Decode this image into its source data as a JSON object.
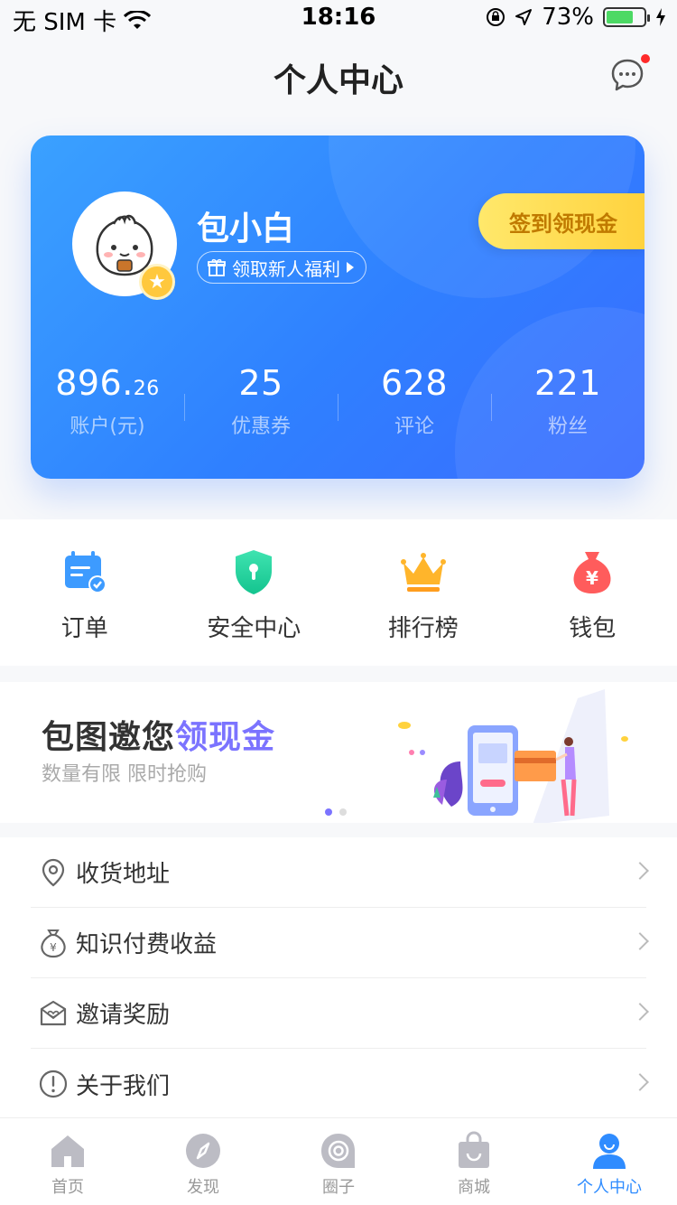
{
  "status_bar": {
    "carrier": "无 SIM 卡",
    "time": "18:16",
    "battery_percent": "73%",
    "battery_level": 0.73
  },
  "nav": {
    "title": "个人中心"
  },
  "profile": {
    "username": "包小白",
    "gift_label": "领取新人福利",
    "checkin_label": "签到领现金",
    "stats": [
      {
        "value_main": "896.",
        "value_small": "26",
        "label": "账户(元)"
      },
      {
        "value_main": "25",
        "value_small": "",
        "label": "优惠券"
      },
      {
        "value_main": "628",
        "value_small": "",
        "label": "评论"
      },
      {
        "value_main": "221",
        "value_small": "",
        "label": "粉丝"
      }
    ]
  },
  "quick_actions": [
    {
      "label": "订单",
      "icon": "calendar-check-icon"
    },
    {
      "label": "安全中心",
      "icon": "shield-icon"
    },
    {
      "label": "排行榜",
      "icon": "crown-icon"
    },
    {
      "label": "钱包",
      "icon": "money-bag-icon"
    }
  ],
  "banner": {
    "title_prefix": "包图邀您",
    "title_highlight": "领现金",
    "subtitle": "数量有限 限时抢购"
  },
  "menu": [
    {
      "label": "收货地址",
      "icon": "location-pin-icon"
    },
    {
      "label": "知识付费收益",
      "icon": "yuan-bag-icon"
    },
    {
      "label": "邀请奖励",
      "icon": "envelope-heart-icon"
    },
    {
      "label": "关于我们",
      "icon": "info-circle-icon"
    }
  ],
  "tabbar": [
    {
      "label": "首页",
      "icon": "home-icon",
      "active": false
    },
    {
      "label": "发现",
      "icon": "compass-icon",
      "active": false
    },
    {
      "label": "圈子",
      "icon": "circle-target-icon",
      "active": false
    },
    {
      "label": "商城",
      "icon": "shopping-bag-icon",
      "active": false
    },
    {
      "label": "个人中心",
      "icon": "user-icon",
      "active": true
    }
  ],
  "colors": {
    "card_gradient_start": "#3aa1ff",
    "card_gradient_end": "#3a6cff",
    "checkin_yellow": "#ffd23d",
    "accent_purple": "#7b73ff",
    "tab_active": "#2f8cff",
    "notification_red": "#ff2a2a"
  }
}
